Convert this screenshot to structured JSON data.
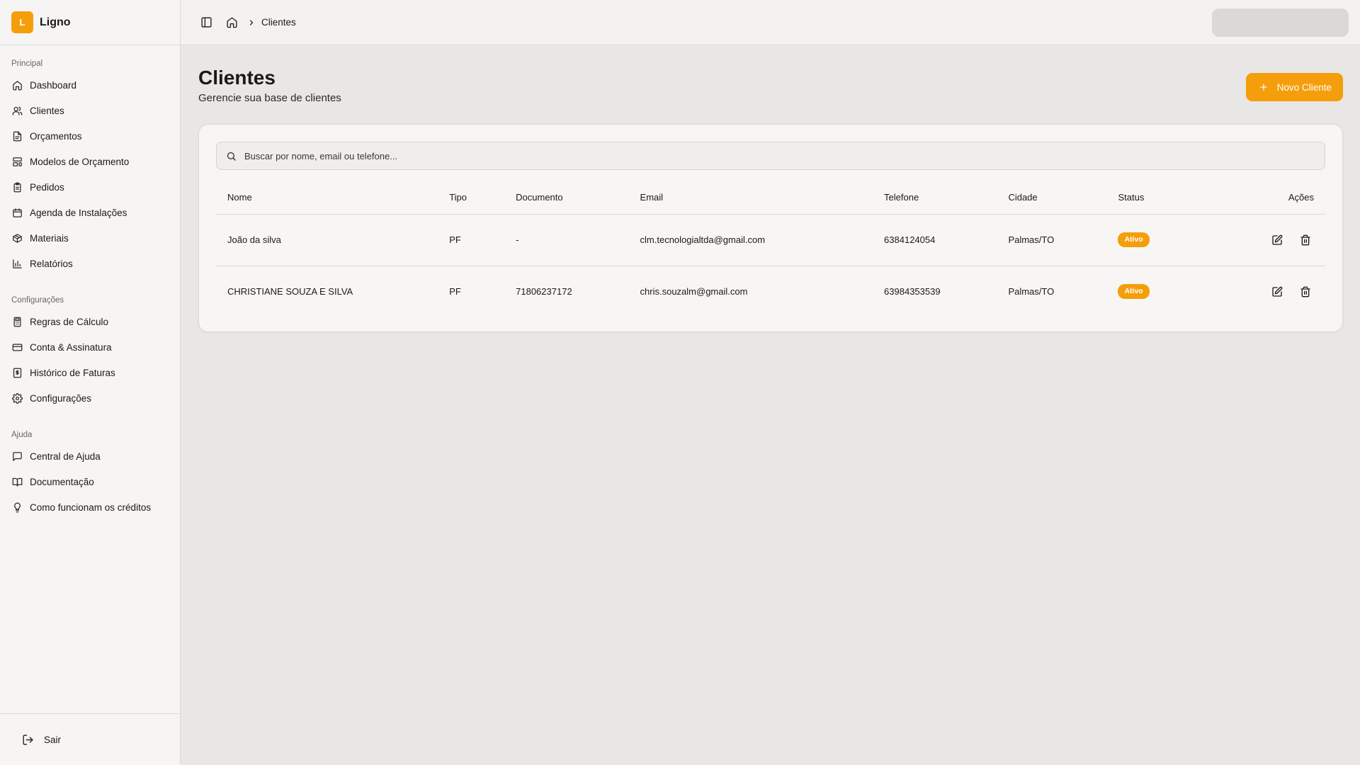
{
  "app": {
    "logo_letter": "L",
    "name": "Ligno"
  },
  "sidebar": {
    "groups": [
      {
        "label": "Principal",
        "items": [
          {
            "label": "Dashboard",
            "icon": "home-icon"
          },
          {
            "label": "Clientes",
            "icon": "users-icon"
          },
          {
            "label": "Orçamentos",
            "icon": "file-text-icon"
          },
          {
            "label": "Modelos de Orçamento",
            "icon": "layout-template-icon"
          },
          {
            "label": "Pedidos",
            "icon": "clipboard-icon"
          },
          {
            "label": "Agenda de Instalações",
            "icon": "calendar-icon"
          },
          {
            "label": "Materiais",
            "icon": "package-icon"
          },
          {
            "label": "Relatórios",
            "icon": "bar-chart-icon"
          }
        ]
      },
      {
        "label": "Configurações",
        "items": [
          {
            "label": "Regras de Cálculo",
            "icon": "calculator-icon"
          },
          {
            "label": "Conta & Assinatura",
            "icon": "credit-card-icon"
          },
          {
            "label": "Histórico de Faturas",
            "icon": "receipt-icon"
          },
          {
            "label": "Configurações",
            "icon": "gear-icon"
          }
        ]
      },
      {
        "label": "Ajuda",
        "items": [
          {
            "label": "Central de Ajuda",
            "icon": "message-square-icon"
          },
          {
            "label": "Documentação",
            "icon": "book-open-icon"
          },
          {
            "label": "Como funcionam os créditos",
            "icon": "lightbulb-icon"
          }
        ]
      }
    ],
    "logout_label": "Sair"
  },
  "header": {
    "breadcrumb_current": "Clientes"
  },
  "page": {
    "title": "Clientes",
    "subtitle": "Gerencie sua base de clientes",
    "new_button_label": "Novo Cliente"
  },
  "search": {
    "placeholder": "Buscar por nome, email ou telefone...",
    "value": ""
  },
  "table": {
    "columns": [
      "Nome",
      "Tipo",
      "Documento",
      "Email",
      "Telefone",
      "Cidade",
      "Status",
      "Ações"
    ],
    "rows": [
      {
        "nome": "João da silva",
        "tipo": "PF",
        "documento": "-",
        "email": "clm.tecnologialtda@gmail.com",
        "telefone": "6384124054",
        "cidade": "Palmas/TO",
        "status": "Ativo"
      },
      {
        "nome": "CHRISTIANE SOUZA E SILVA",
        "tipo": "PF",
        "documento": "71806237172",
        "email": "chris.souzalm@gmail.com",
        "telefone": "63984353539",
        "cidade": "Palmas/TO",
        "status": "Ativo"
      }
    ]
  },
  "colors": {
    "accent": "#f59e0b",
    "sidebar_bg": "#f6f5f3",
    "page_bg": "#e8e7e5",
    "card_bg": "#f7f6f4"
  }
}
